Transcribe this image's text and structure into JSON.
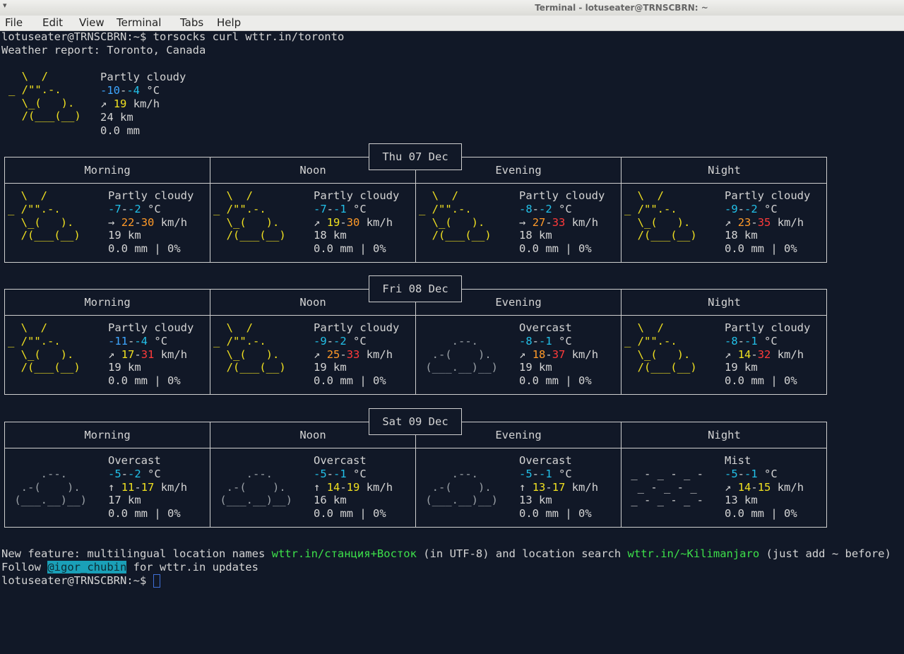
{
  "window": {
    "title": "Terminal - lotuseater@TRNSCBRN: ~"
  },
  "menu": [
    "File",
    "Edit",
    "View",
    "Terminal",
    "Tabs",
    "Help"
  ],
  "prompt": "lotuseater@TRNSCBRN:~$",
  "command": "torsocks curl wttr.in/toronto",
  "report_line": "Weather report: Toronto, Canada",
  "current": {
    "condition": "Partly cloudy",
    "temp_low": "-10",
    "temp_high": "-4",
    "temp_unit": "°C",
    "wind_arrow": "↗",
    "wind": "19",
    "wind_unit": "km/h",
    "visibility": "24 km",
    "precip": "0.0 mm"
  },
  "art": {
    "partly_cloudy": [
      "  \\  /      ",
      "_ /\"\".-.    ",
      "  \\_(   ).  ",
      "  /(___(__) "
    ],
    "overcast": [
      "            ",
      "     .--.   ",
      "  .-(    ). ",
      " (___.__)__)"
    ],
    "mist": [
      "            ",
      " _ - _ - _ - ",
      "  _ - _ - _ ",
      " _ - _ - _ -"
    ]
  },
  "periods": [
    "Morning",
    "Noon",
    "Evening",
    "Night"
  ],
  "days": [
    {
      "date": "Thu 07 Dec",
      "slots": [
        {
          "art": "partly_cloudy",
          "condition": "Partly cloudy",
          "t1": "-7",
          "t1c": "c",
          "t2": "-2",
          "t2c": "c",
          "arrow": "→",
          "w1": "22",
          "w1c": "o",
          "w2": "30",
          "w2c": "o",
          "vis": "19 km",
          "precip": "0.0 mm | 0%"
        },
        {
          "art": "partly_cloudy",
          "condition": "Partly cloudy",
          "t1": "-7",
          "t1c": "c",
          "t2": "-1",
          "t2c": "c",
          "arrow": "↗",
          "w1": "19",
          "w1c": "y",
          "w2": "30",
          "w2c": "o",
          "vis": "18 km",
          "precip": "0.0 mm | 0%"
        },
        {
          "art": "partly_cloudy",
          "condition": "Partly cloudy",
          "t1": "-8",
          "t1c": "c",
          "t2": "-2",
          "t2c": "c",
          "arrow": "→",
          "w1": "27",
          "w1c": "o",
          "w2": "33",
          "w2c": "r",
          "vis": "18 km",
          "precip": "0.0 mm | 0%"
        },
        {
          "art": "partly_cloudy",
          "condition": "Partly cloudy",
          "t1": "-9",
          "t1c": "c",
          "t2": "-2",
          "t2c": "c",
          "arrow": "↗",
          "w1": "23",
          "w1c": "o",
          "w2": "35",
          "w2c": "r",
          "vis": "18 km",
          "precip": "0.0 mm | 0%"
        }
      ]
    },
    {
      "date": "Fri 08 Dec",
      "slots": [
        {
          "art": "partly_cloudy",
          "condition": "Partly cloudy",
          "t1": "-11",
          "t1c": "b",
          "t2": "-4",
          "t2c": "c",
          "arrow": "↗",
          "w1": "17",
          "w1c": "y",
          "w2": "31",
          "w2c": "r",
          "vis": "19 km",
          "precip": "0.0 mm | 0%"
        },
        {
          "art": "partly_cloudy",
          "condition": "Partly cloudy",
          "t1": "-9",
          "t1c": "c",
          "t2": "-2",
          "t2c": "c",
          "arrow": "↗",
          "w1": "25",
          "w1c": "o",
          "w2": "33",
          "w2c": "r",
          "vis": "19 km",
          "precip": "0.0 mm | 0%"
        },
        {
          "art": "overcast",
          "condition": "Overcast",
          "t1": "-8",
          "t1c": "c",
          "t2": "-1",
          "t2c": "c",
          "arrow": "↗",
          "w1": "18",
          "w1c": "o",
          "w2": "37",
          "w2c": "r",
          "vis": "19 km",
          "precip": "0.0 mm | 0%"
        },
        {
          "art": "partly_cloudy",
          "condition": "Partly cloudy",
          "t1": "-8",
          "t1c": "c",
          "t2": "-1",
          "t2c": "c",
          "arrow": "↗",
          "w1": "14",
          "w1c": "y",
          "w2": "32",
          "w2c": "r",
          "vis": "19 km",
          "precip": "0.0 mm | 0%"
        }
      ]
    },
    {
      "date": "Sat 09 Dec",
      "slots": [
        {
          "art": "overcast",
          "condition": "Overcast",
          "t1": "-5",
          "t1c": "c",
          "t2": "-2",
          "t2c": "c",
          "arrow": "↑",
          "w1": "11",
          "w1c": "y",
          "w2": "17",
          "w2c": "y",
          "vis": "17 km",
          "precip": "0.0 mm | 0%"
        },
        {
          "art": "overcast",
          "condition": "Overcast",
          "t1": "-5",
          "t1c": "c",
          "t2": "-1",
          "t2c": "c",
          "arrow": "↑",
          "w1": "14",
          "w1c": "y",
          "w2": "19",
          "w2c": "y",
          "vis": "16 km",
          "precip": "0.0 mm | 0%"
        },
        {
          "art": "overcast",
          "condition": "Overcast",
          "t1": "-5",
          "t1c": "c",
          "t2": "-1",
          "t2c": "c",
          "arrow": "↑",
          "w1": "13",
          "w1c": "y",
          "w2": "17",
          "w2c": "y",
          "vis": "13 km",
          "precip": "0.0 mm | 0%"
        },
        {
          "art": "mist",
          "condition": "Mist",
          "t1": "-5",
          "t1c": "c",
          "t2": "-1",
          "t2c": "c",
          "arrow": "↗",
          "w1": "14",
          "w1c": "y",
          "w2": "15",
          "w2c": "y",
          "vis": "13 km",
          "precip": "0.0 mm | 0%"
        }
      ]
    }
  ],
  "footer": {
    "f1a": "New feature: multilingual location names ",
    "f1b": "wttr.in/станция+Восток",
    "f1c": " (in UTF-8) and location search ",
    "f1d": "wttr.in/~Kilimanjaro",
    "f1e": " (just add ~ before)",
    "f2a": "Follow ",
    "f2b": "@igor_chubin",
    "f2c": " for wttr.in updates"
  },
  "colors": {
    "bg": "#111827",
    "yellow": "#f0e020",
    "cyan": "#22c0e8",
    "blue": "#3ea6ff",
    "orange": "#ff9a28",
    "red": "#ff3a3a",
    "green": "#3de04a"
  }
}
